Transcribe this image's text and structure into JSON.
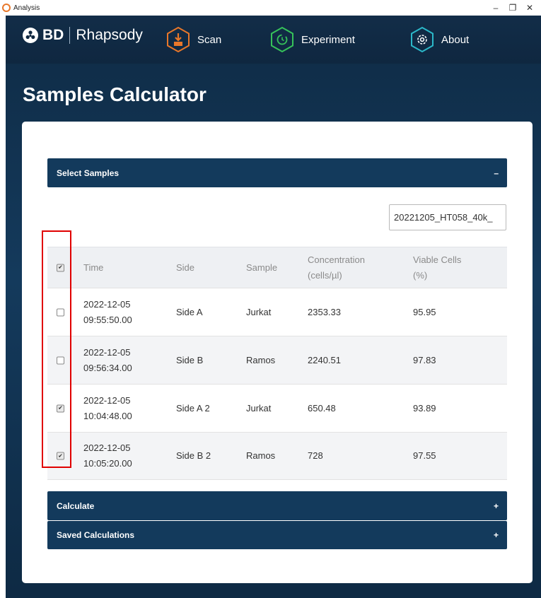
{
  "window": {
    "title": "Analysis",
    "controls": [
      "–",
      "❐",
      "✕"
    ]
  },
  "nav": {
    "brand_bd": "BD",
    "brand_name": "Rhapsody",
    "scan_label": "Scan",
    "experiment_label": "Experiment",
    "about_label": "About",
    "colors": {
      "scan": "#e8772a",
      "experiment": "#36c25a",
      "about": "#2bb8c9"
    },
    "icons": [
      "bd-logo-icon",
      "scan-icon",
      "experiment-icon",
      "about-icon"
    ]
  },
  "page": {
    "title": "Samples Calculator"
  },
  "select_samples": {
    "header": "Select Samples",
    "toggle": "–",
    "experiment_value": "20221205_HT058_40k_"
  },
  "table": {
    "headers": {
      "time": "Time",
      "side": "Side",
      "sample": "Sample",
      "conc_line1": "Concentration",
      "conc_line2": "(cells/µl)",
      "viable_line1": "Viable Cells",
      "viable_line2": "(%)"
    },
    "header_checked": true,
    "rows": [
      {
        "checked": false,
        "date": "2022-12-05",
        "clock": "09:55:50.00",
        "side": "Side A",
        "sample": "Jurkat",
        "concentration": "2353.33",
        "viable": "95.95"
      },
      {
        "checked": false,
        "date": "2022-12-05",
        "clock": "09:56:34.00",
        "side": "Side B",
        "sample": "Ramos",
        "concentration": "2240.51",
        "viable": "97.83"
      },
      {
        "checked": true,
        "date": "2022-12-05",
        "clock": "10:04:48.00",
        "side": "Side A 2",
        "sample": "Jurkat",
        "concentration": "650.48",
        "viable": "93.89"
      },
      {
        "checked": true,
        "date": "2022-12-05",
        "clock": "10:05:20.00",
        "side": "Side B 2",
        "sample": "Ramos",
        "concentration": "728",
        "viable": "97.55"
      }
    ]
  },
  "calculate": {
    "header": "Calculate",
    "toggle": "+"
  },
  "saved": {
    "header": "Saved Calculations",
    "toggle": "+"
  },
  "checkbox_mark": "✔",
  "accent_colors": {
    "header_bg": "#133a5c",
    "highlight": "#e00000"
  }
}
